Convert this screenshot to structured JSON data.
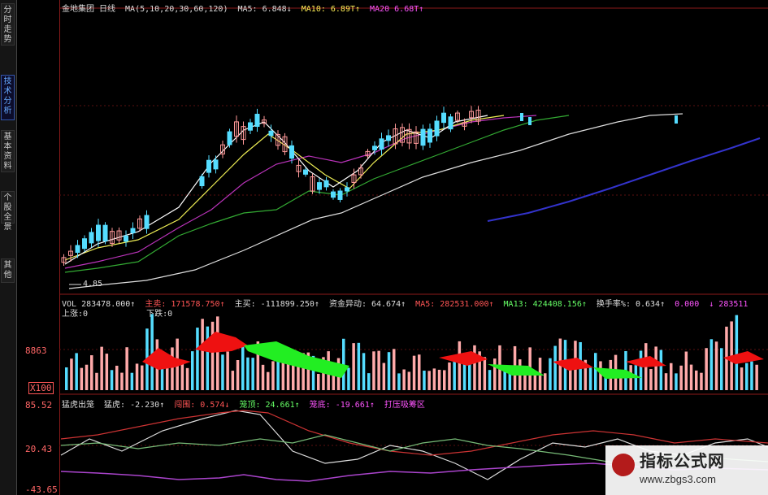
{
  "sidebar": {
    "tabs": [
      {
        "label": "分时走势",
        "active": false
      },
      {
        "label": "技术分析",
        "active": true
      },
      {
        "label": "基本资料",
        "active": false
      },
      {
        "label": "个股全景",
        "active": false
      },
      {
        "label": "其他",
        "active": false
      }
    ]
  },
  "main_panel": {
    "stock_name": "金地集团",
    "period": "日线",
    "ma_params": "MA(5,10,20,30,60,120)",
    "ma5": "MA5: 6.848↓",
    "ma10": "MA10: 6.89T↑",
    "ma20": "MA20  6.68T↑",
    "low_price": "4.85"
  },
  "volume_panel": {
    "vol": "VOL 283478.000↑",
    "sell_label": "主卖:",
    "sell": "171578.750↑",
    "buy_label": "主买:",
    "buy": "-111899.250↑",
    "fund_label": "资金异动:",
    "fund": "64.674↑",
    "ma5": "MA5: 282531.000↑",
    "ma13": "MA13: 424408.156↑",
    "turnover_label": "换手率%:",
    "turnover": "0.634↑",
    "extra1": "0.000",
    "extra2": "↓ 283511",
    "rise_label": "上涨:0",
    "fall_label": "下跌:0",
    "scale_label": "8863",
    "unit_label": "X100"
  },
  "indicator_panel": {
    "name": "猛虎出笼",
    "tiger": "猛虎: -2.230↑",
    "chuang": "闯围: 0.574↓",
    "ling": "笼顶: 24.661↑",
    "long_diff": "笼底: -19.661↑",
    "zone": "打压吸筹区",
    "axis_top": "85.52",
    "axis_mid": "20.43",
    "axis_bot": "-43.65"
  },
  "watermark": {
    "title": "指标公式网",
    "url": "www.zbgs3.com"
  },
  "colors": {
    "up": "#ff9999",
    "down": "#55ddff",
    "grid": "#8b1a1a",
    "ma_white": "#eeeeee",
    "ma_yellow": "#ffee55",
    "ma_magenta": "#cc44cc",
    "ma_green": "#44cc44",
    "ma_blue": "#3333cc"
  }
}
